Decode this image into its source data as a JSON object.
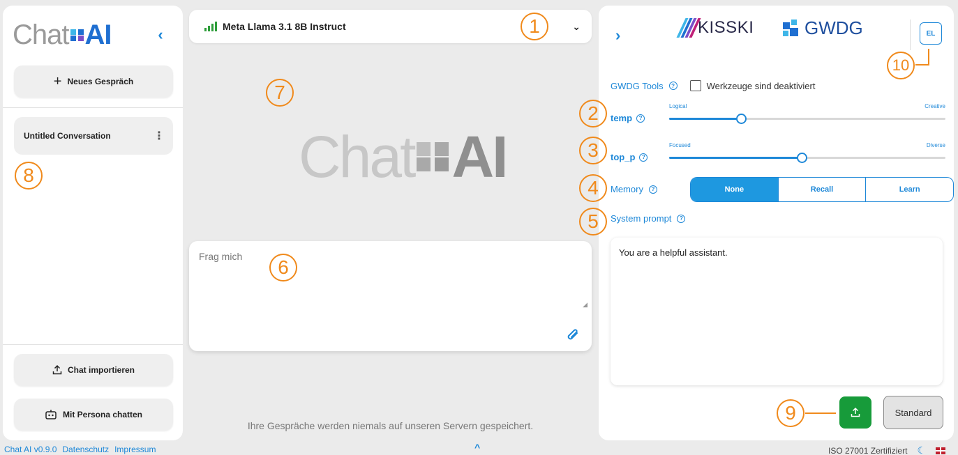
{
  "sidebar": {
    "logo_chat": "Chat",
    "logo_ai": "AI",
    "new_chat_label": "Neues Gespräch",
    "conversations": [
      {
        "title": "Untitled Conversation"
      }
    ],
    "import_label": "Chat importieren",
    "persona_label": "Mit Persona chatten"
  },
  "header": {
    "model_name": "Meta Llama 3.1 8B Instruct"
  },
  "main": {
    "logo_chat": "Chat",
    "logo_ai": "AI",
    "input_placeholder": "Frag mich",
    "privacy_note": "Ihre Gespräche werden niemals auf unseren Servern gespeichert."
  },
  "settings": {
    "brand_kisski": "KISSKI",
    "brand_gwdg": "GWDG",
    "avatar_initials": "EL",
    "tools_label": "GWDG Tools",
    "tools_status": "Werkzeuge sind deaktiviert",
    "temp": {
      "label": "temp",
      "left": "Logical",
      "right": "Creative",
      "value": 0.26
    },
    "top_p": {
      "label": "top_p",
      "left": "Focused",
      "right": "Diverse",
      "value": 0.48
    },
    "memory": {
      "label": "Memory",
      "options": [
        "None",
        "Recall",
        "Learn"
      ],
      "selected": "None"
    },
    "system_prompt": {
      "label": "System prompt",
      "value": "You are a helpful assistant."
    },
    "standard_label": "Standard"
  },
  "footer": {
    "version": "Chat AI v0.9.0",
    "privacy": "Datenschutz",
    "imprint": "Impressum",
    "certification": "ISO 27001 Zertifiziert"
  },
  "annotations": [
    "1",
    "2",
    "3",
    "4",
    "5",
    "6",
    "7",
    "8",
    "9",
    "10"
  ],
  "colors": {
    "accent": "#1e88d8",
    "annotation": "#f08a1c",
    "export_button": "#179b3a",
    "signal": "#2e9d3a"
  }
}
